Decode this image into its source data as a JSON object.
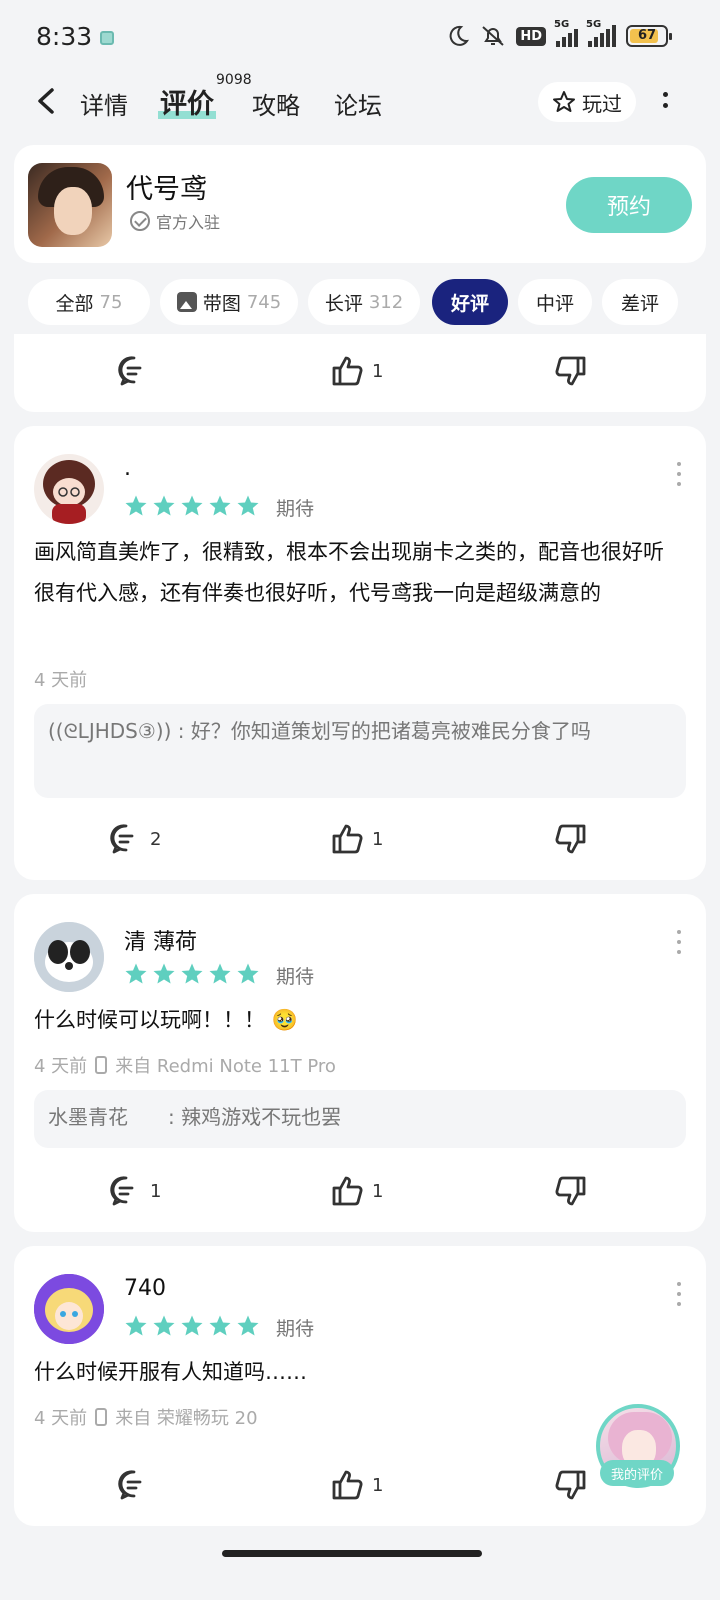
{
  "status": {
    "time": "8:33",
    "network1": "5G",
    "network2": "5G",
    "battery": "67"
  },
  "nav": {
    "tabs": [
      "详情",
      "评价",
      "攻略",
      "论坛"
    ],
    "review_count": "9098",
    "played_label": "玩过"
  },
  "game": {
    "name": "代号鸢",
    "official_label": "官方入驻",
    "reserve_label": "预约"
  },
  "filters": [
    {
      "label": "全部",
      "count": "75"
    },
    {
      "label": "带图",
      "count": "745"
    },
    {
      "label": "长评",
      "count": "312"
    },
    {
      "label": "好评",
      "count": ""
    },
    {
      "label": "中评",
      "count": ""
    },
    {
      "label": "差评",
      "count": ""
    }
  ],
  "top_card": {
    "like_count": "1"
  },
  "reviews": [
    {
      "username": ".",
      "rating_label": "期待",
      "stars": 5,
      "text": "画风简直美炸了，很精致，根本不会出现崩卡之类的，配音也很好听很有代入感，还有伴奏也很好听，代号鸢我一向是超级满意的",
      "time": "4 天前",
      "device": "",
      "reply": "((ᘓLJHDS③)) : 好？你知道策划写的把诸葛亮被难民分食了吗",
      "comment_count": "2",
      "like_count": "1"
    },
    {
      "username": "清 薄荷",
      "rating_label": "期待",
      "stars": 5,
      "text": "什么时候可以玩啊！！！ 🥹",
      "time": "4 天前",
      "device": "来自 Redmi Note 11T Pro",
      "reply": "水墨青花　　: 辣鸡游戏不玩也罢",
      "comment_count": "1",
      "like_count": "1"
    },
    {
      "username": "740",
      "rating_label": "期待",
      "stars": 5,
      "text": "什么时候开服有人知道吗……",
      "time": "4 天前",
      "device": "来自 荣耀畅玩 20",
      "reply": "",
      "comment_count": "",
      "like_count": "1"
    }
  ],
  "floating": {
    "my_review_label": "我的评价"
  },
  "colors": {
    "accent": "#6fd6c6",
    "active_chip": "#1a237e",
    "star": "#5fcfbf"
  }
}
